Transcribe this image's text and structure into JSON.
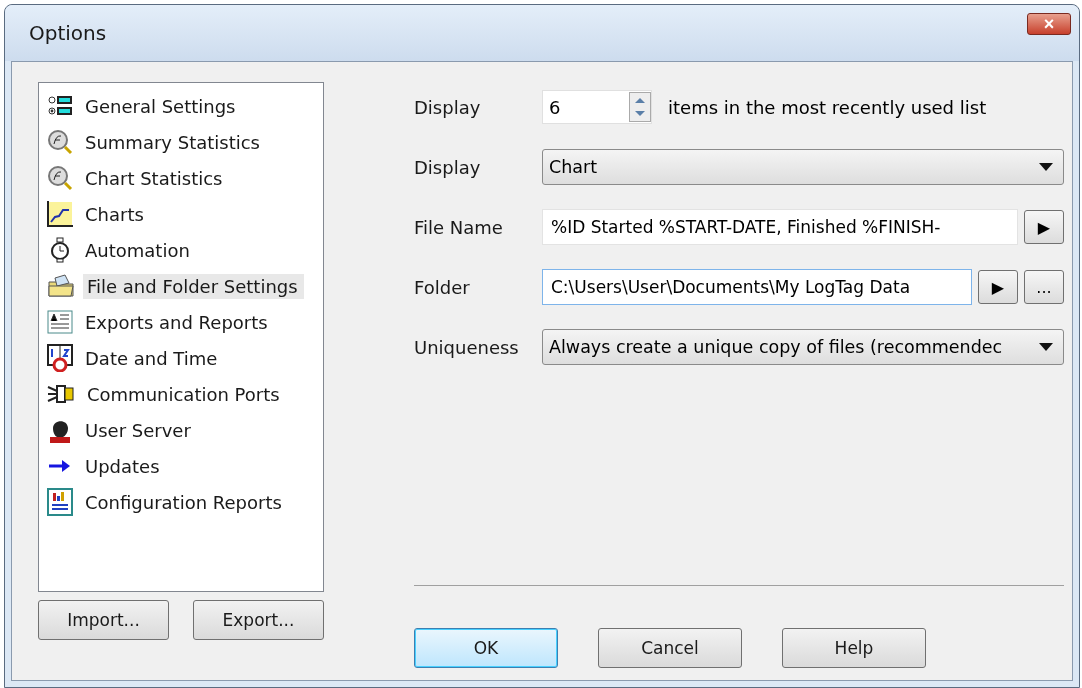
{
  "window": {
    "title": "Options",
    "close": "×"
  },
  "sidebar": {
    "items": [
      {
        "label": "General Settings",
        "selected": false
      },
      {
        "label": "Summary Statistics",
        "selected": false
      },
      {
        "label": "Chart Statistics",
        "selected": false
      },
      {
        "label": "Charts",
        "selected": false
      },
      {
        "label": "Automation",
        "selected": false
      },
      {
        "label": "File and Folder Settings",
        "selected": true
      },
      {
        "label": "Exports and Reports",
        "selected": false
      },
      {
        "label": "Date and Time",
        "selected": false
      },
      {
        "label": "Communication Ports",
        "selected": false
      },
      {
        "label": "User Server",
        "selected": false
      },
      {
        "label": "Updates",
        "selected": false
      },
      {
        "label": "Configuration Reports",
        "selected": false
      }
    ]
  },
  "form": {
    "rows": [
      {
        "kind": "spinner",
        "label": "Display",
        "value": "6",
        "suffix": "items in the most recently used list"
      },
      {
        "kind": "dropdown",
        "label": "Display",
        "value": "Chart"
      },
      {
        "kind": "text",
        "label": "File Name",
        "value": "%ID Started %START-DATE, Finished %FINISH-",
        "buttons": [
          "▶"
        ]
      },
      {
        "kind": "text",
        "label": "Folder",
        "value": "C:\\Users\\User\\Documents\\My LogTag Data",
        "focused": true,
        "buttons": [
          "▶",
          "..."
        ]
      },
      {
        "kind": "dropdown",
        "label": "Uniqueness",
        "value": "Always create a unique copy of files (recommendec"
      }
    ]
  },
  "left_buttons": [
    "Import...",
    "Export..."
  ],
  "buttons": [
    {
      "label": "OK",
      "default": true
    },
    {
      "label": "Cancel",
      "default": false
    },
    {
      "label": "Help",
      "default": false
    }
  ]
}
